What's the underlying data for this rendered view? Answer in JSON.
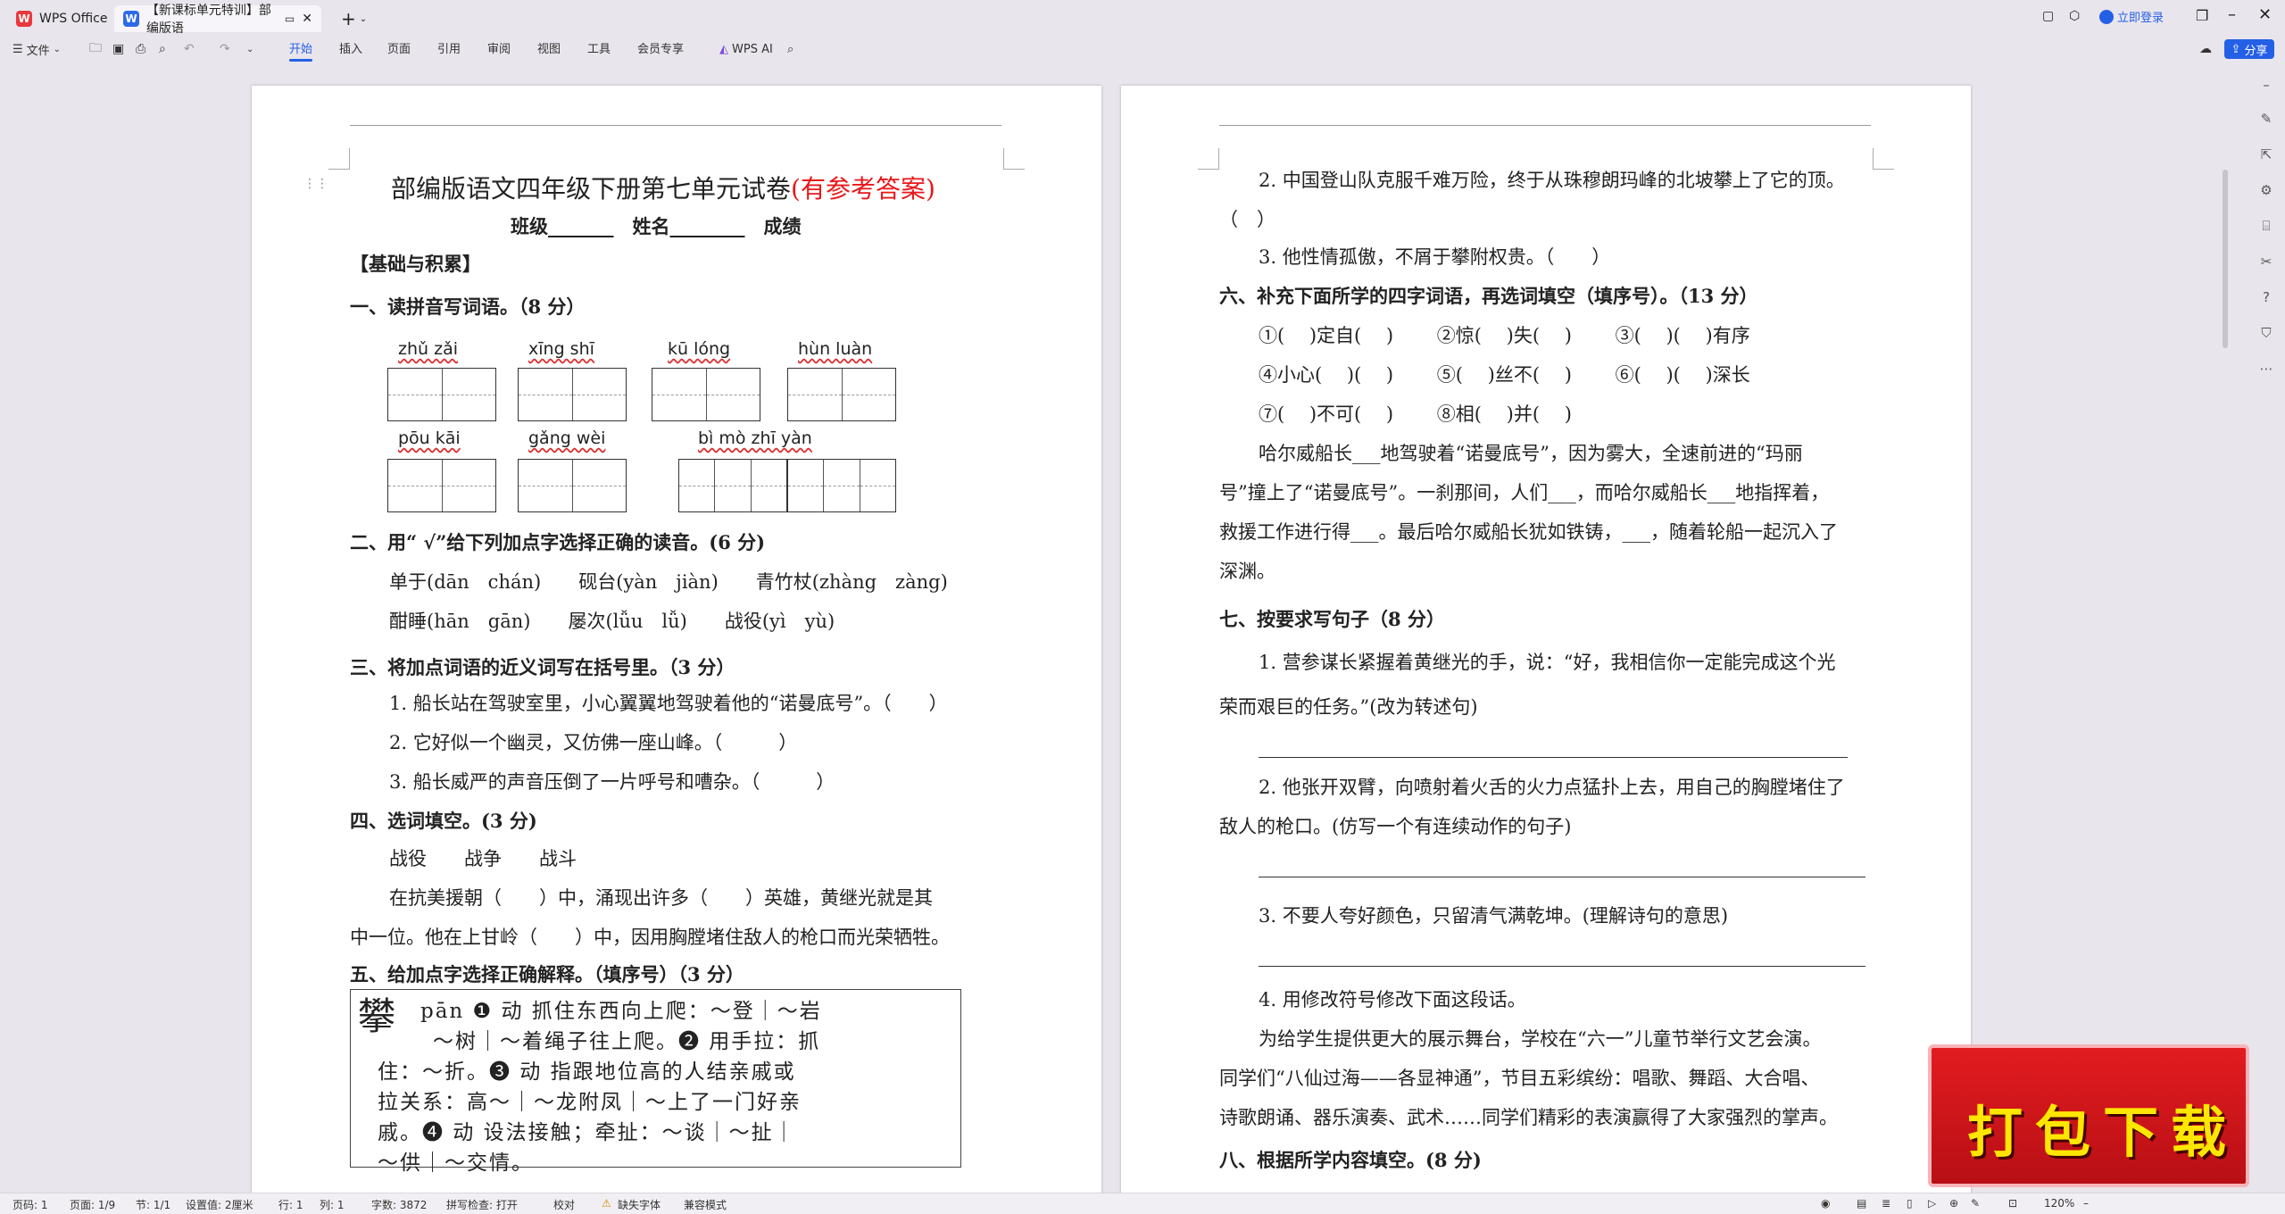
{
  "titlebar": {
    "home_tab": "WPS Office",
    "doc_tab": "【新课标单元特训】部编版语",
    "new_tab": "+",
    "login": "立即登录"
  },
  "toolbar": {
    "file_menu": "文件",
    "tabs": [
      "开始",
      "插入",
      "页面",
      "引用",
      "审阅",
      "视图",
      "工具",
      "会员专享"
    ],
    "ai": "WPS AI",
    "share": "分享"
  },
  "page1": {
    "title_main": "部编版语文四年级下册第七单元试卷",
    "title_red": "(有参考答案)",
    "subline": "班级_______　姓名________　成绩",
    "section_basic": "【基础与积累】",
    "q1": "一、读拼音写词语。（8 分）",
    "pinyin_row1": [
      "zhǔ  zǎi",
      "xīng  shī",
      "kū  lóng",
      "hùn  luàn"
    ],
    "pinyin_row2": [
      "pōu  kāi",
      "gǎng  wèi",
      "bì   mò   zhī   yàn"
    ],
    "q2": "二、用“ √”给下列加点字选择正确的读音。(6 分)",
    "q2_line1": "单于(dān　chán)　　砚台(yàn　jiàn)　　青竹杖(zhàng　zàng)",
    "q2_line2": "酣睡(hān　gān)　　屡次(lǚu　lǚ)　　战役(yì　yù)",
    "q3": "三、将加点词语的近义词写在括号里。（3 分）",
    "q3_1": "1. 船长站在驾驶室里，小心翼翼地驾驶着他的“诺曼底号”。（　　）",
    "q3_2": "2. 它好似一个幽灵，又仿佛一座山峰。（　　　）",
    "q3_3": "3. 船长威严的声音压倒了一片呼号和嘈杂。（　　　）",
    "q4": "四、选词填空。(3 分)",
    "q4_words": "战役　　战争　　战斗",
    "q4_p1": "在抗美援朝（　　）中，涌现出许多（　　）英雄，黄继光就是其",
    "q4_p2": "中一位。他在上甘岭（　　）中，因用胸膛堵住敌人的枪口而光荣牺牲。",
    "q5": "五、给加点字选择正确解释。（填序号）（3 分）",
    "dict_char": "攀",
    "dict_l1": "pān ❶ 动 抓住东西向上爬：～登｜～岩",
    "dict_l2": "～树｜～着绳子往上爬。❷ 用手拉：抓",
    "dict_l3": "住：～折。❸ 动 指跟地位高的人结亲戚或",
    "dict_l4": "拉关系：高～｜～龙附凤｜～上了一门好亲",
    "dict_l5": "戚。❹ 动 设法接触；牵扯：～谈｜～扯｜",
    "dict_l6": "～供｜～交情。"
  },
  "page2": {
    "l1": "2. 中国登山队克服千难万险，终于从珠穆朗玛峰的北坡攀上了它的顶。",
    "l2": "（　）",
    "l3": "3. 他性情孤傲，不屑于攀附权贵。（　　）",
    "q6": "六、补充下面所学的四字词语，再选词填空（填序号）。（13 分）",
    "w1": "①(　 )定自(　 )　　 ②惊(　 )失(　 )　　 ③(　 )(　 )有序",
    "w2": "④小心(　 )(　 )　　 ⑤(　 )丝不(　 )　　 ⑥(　 )(　 )深长",
    "w3": "⑦(　 )不可(　 )　　 ⑧相(　 )并(　 )",
    "p1": "哈尔威船长___地驾驶着“诺曼底号”，因为雾大，全速前进的“玛丽",
    "p2": "号”撞上了“诺曼底号”。一刹那间，人们___，而哈尔威船长___地指挥着，",
    "p3": "救援工作进行得___。最后哈尔威船长犹如铁铸，___，随着轮船一起沉入了",
    "p4": "深渊。",
    "q7": "七、按要求写句子（8 分）",
    "s1a": "1. 营参谋长紧握着黄继光的手，说：“好，我相信你一定能完成这个光",
    "s1b": "荣而艰巨的任务。”(改为转述句)",
    "s2a": "2. 他张开双臂，向喷射着火舌的火力点猛扑上去，用自己的胸膛堵住了",
    "s2b": "敌人的枪口。(仿写一个有连续动作的句子)",
    "s3": "3. 不要人夸好颜色，只留清气满乾坤。(理解诗句的意思)",
    "s4": "4. 用修改符号修改下面这段话。",
    "s4p1": "为给学生提供更大的展示舞台，学校在“六一”儿童节举行文艺会演。",
    "s4p2": "同学们“八仙过海——各显神通”，节目五彩缤纷：唱歌、舞蹈、大合唱、",
    "s4p3": "诗歌朗诵、器乐演奏、武术……同学们精彩的表演赢得了大家强烈的掌声。",
    "q8": "八、根据所学内容填空。(8 分)"
  },
  "statusbar": {
    "page_code": "页码: 1",
    "pages": "页面: 1/9",
    "section": "节: 1/1",
    "setting": "设置值: 2厘米",
    "row": "行: 1",
    "col": "列: 1",
    "words": "字数: 3872",
    "spell": "拼写检查: 打开",
    "proof": "校对",
    "missing_font": "缺失字体",
    "compat": "兼容模式",
    "zoom": "120%"
  },
  "banner": {
    "text": "打包下载"
  }
}
